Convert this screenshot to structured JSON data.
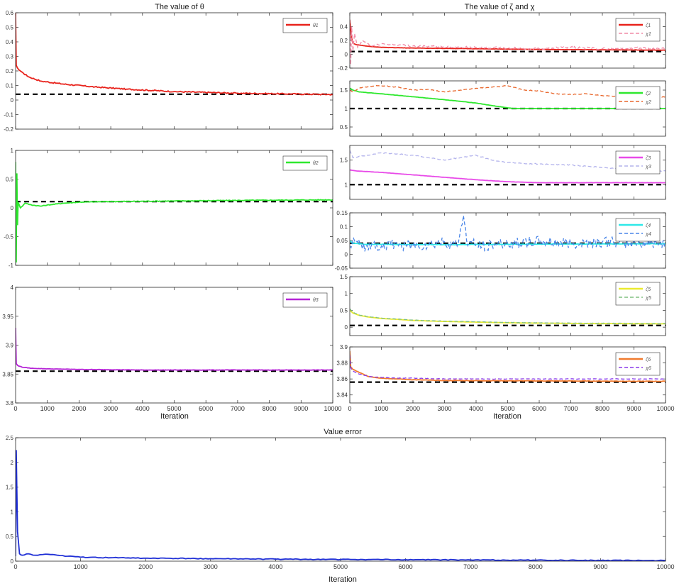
{
  "figure": {
    "title_theta": "The value of θ",
    "title_zeta": "The value of ζ and χ",
    "title_error": "Value error",
    "xlabel": "Iteration"
  },
  "colors": {
    "reference_line": "#000000",
    "axis": "#262626"
  },
  "chart_data": [
    {
      "id": "theta1",
      "type": "line",
      "xlim": [
        0,
        10000
      ],
      "ylim": [
        -0.2,
        0.6
      ],
      "yticks": [
        "-0.2",
        "-0.1",
        "0",
        "0.1",
        "0.2",
        "0.3",
        "0.4",
        "0.5",
        "0.6"
      ],
      "reference": 0.04,
      "series": [
        {
          "name": "θ1",
          "color": "#e8231c",
          "dash": false,
          "noise": 0.004,
          "x": [
            0,
            20,
            60,
            150,
            400,
            800,
            1500,
            2500,
            3500,
            5000,
            7000,
            10000
          ],
          "y": [
            0.6,
            0.24,
            0.22,
            0.2,
            0.16,
            0.13,
            0.11,
            0.09,
            0.075,
            0.058,
            0.047,
            0.038
          ]
        }
      ]
    },
    {
      "id": "theta2",
      "type": "line",
      "xlim": [
        0,
        10000
      ],
      "ylim": [
        -1,
        1
      ],
      "yticks": [
        "-1",
        "-0.5",
        "0",
        "0.5",
        "1"
      ],
      "reference": 0.11,
      "series": [
        {
          "name": "θ2",
          "color": "#2ee82e",
          "dash": false,
          "noise": 0.006,
          "x": [
            0,
            20,
            40,
            60,
            80,
            150,
            300,
            500,
            800,
            1000,
            1500,
            2000,
            3000,
            5000,
            7000,
            10000
          ],
          "y": [
            0.8,
            -0.95,
            0.6,
            -0.3,
            0.1,
            0.0,
            0.08,
            0.05,
            0.03,
            0.05,
            0.08,
            0.1,
            0.11,
            0.12,
            0.13,
            0.14
          ]
        }
      ]
    },
    {
      "id": "theta3",
      "type": "line",
      "xlim": [
        0,
        10000
      ],
      "ylim": [
        3.8,
        4.0
      ],
      "yticks": [
        "3.8",
        "3.85",
        "3.9",
        "3.95",
        "4"
      ],
      "reference": 3.855,
      "series": [
        {
          "name": "θ3",
          "color": "#b524d6",
          "dash": false,
          "noise": 0.0003,
          "x": [
            0,
            20,
            60,
            200,
            500,
            1000,
            2000,
            4000,
            10000
          ],
          "y": [
            3.93,
            3.868,
            3.865,
            3.862,
            3.86,
            3.859,
            3.858,
            3.857,
            3.857
          ]
        }
      ]
    },
    {
      "id": "zeta1",
      "type": "line",
      "xlim": [
        0,
        10000
      ],
      "ylim": [
        -0.2,
        0.6
      ],
      "yticks": [
        "-0.2",
        "0",
        "0.2",
        "0.4"
      ],
      "reference": 0.04,
      "series": [
        {
          "name": "ζ1",
          "color": "#e8231c",
          "dash": false,
          "noise": 0.002,
          "x": [
            0,
            50,
            100,
            200,
            500,
            1000,
            2000,
            4000,
            6000,
            8000,
            10000
          ],
          "y": [
            0.5,
            0.25,
            0.16,
            0.14,
            0.12,
            0.1,
            0.09,
            0.08,
            0.07,
            0.065,
            0.06
          ]
        },
        {
          "name": "χ1",
          "color": "#f08aa6",
          "dash": true,
          "noise": 0.015,
          "x": [
            0,
            30,
            60,
            100,
            150,
            250,
            400,
            700,
            1000,
            2000,
            3000,
            4000,
            5000,
            6000,
            7000,
            8000,
            9000,
            10000
          ],
          "y": [
            0.5,
            -0.15,
            0.4,
            0.05,
            0.3,
            0.1,
            0.2,
            0.12,
            0.15,
            0.12,
            0.11,
            0.1,
            0.09,
            0.08,
            0.1,
            0.08,
            0.09,
            0.08
          ]
        }
      ]
    },
    {
      "id": "zeta2",
      "type": "line",
      "xlim": [
        0,
        10000
      ],
      "ylim": [
        0.25,
        1.75
      ],
      "yticks": [
        "0.5",
        "1",
        "1.5"
      ],
      "reference": 1.0,
      "series": [
        {
          "name": "ζ2",
          "color": "#2ee82e",
          "dash": false,
          "noise": 0.003,
          "x": [
            0,
            100,
            300,
            1000,
            2000,
            3000,
            4000,
            4500,
            5000,
            5200,
            6000,
            10000
          ],
          "y": [
            1.55,
            1.5,
            1.45,
            1.4,
            1.32,
            1.24,
            1.15,
            1.08,
            1.02,
            1.0,
            1.0,
            1.0
          ]
        },
        {
          "name": "χ2",
          "color": "#e8662b",
          "dash": true,
          "noise": 0.01,
          "x": [
            0,
            100,
            300,
            600,
            1000,
            1500,
            2000,
            2500,
            3000,
            3500,
            4000,
            4500,
            5000,
            5500,
            6000,
            6500,
            7000,
            7500,
            8000,
            9000,
            10000
          ],
          "y": [
            1.5,
            1.45,
            1.55,
            1.6,
            1.62,
            1.58,
            1.5,
            1.52,
            1.45,
            1.5,
            1.55,
            1.58,
            1.62,
            1.5,
            1.48,
            1.4,
            1.38,
            1.4,
            1.35,
            1.3,
            1.32
          ]
        }
      ]
    },
    {
      "id": "zeta3",
      "type": "line",
      "xlim": [
        0,
        10000
      ],
      "ylim": [
        0.7,
        1.8
      ],
      "yticks": [
        "1",
        "1.5"
      ],
      "reference": 1.0,
      "series": [
        {
          "name": "ζ3",
          "color": "#e84ae8",
          "dash": false,
          "noise": 0.002,
          "x": [
            0,
            200,
            1000,
            2000,
            3000,
            4000,
            5000,
            6000,
            10000
          ],
          "y": [
            1.3,
            1.28,
            1.25,
            1.2,
            1.15,
            1.1,
            1.06,
            1.04,
            1.04
          ]
        },
        {
          "name": "χ3",
          "color": "#b3b3ec",
          "dash": true,
          "noise": 0.01,
          "x": [
            0,
            100,
            300,
            600,
            1000,
            2000,
            3000,
            3500,
            4000,
            4500,
            5000,
            6000,
            7000,
            8000,
            9000,
            10000
          ],
          "y": [
            1.7,
            1.55,
            1.58,
            1.6,
            1.65,
            1.6,
            1.5,
            1.55,
            1.6,
            1.5,
            1.45,
            1.42,
            1.4,
            1.35,
            1.3,
            1.28
          ]
        }
      ]
    },
    {
      "id": "zeta4",
      "type": "line",
      "xlim": [
        0,
        10000
      ],
      "ylim": [
        -0.05,
        0.15
      ],
      "yticks": [
        "-0.05",
        "0",
        "0.05",
        "0.1",
        "0.15"
      ],
      "reference": 0.04,
      "series": [
        {
          "name": "ζ4",
          "color": "#2ee8e8",
          "dash": false,
          "noise": 0.0008,
          "x": [
            0,
            100,
            500,
            1000,
            3000,
            6000,
            10000
          ],
          "y": [
            0.05,
            0.04,
            0.036,
            0.036,
            0.035,
            0.037,
            0.038
          ]
        },
        {
          "name": "χ4",
          "color": "#4a86e8",
          "dash": true,
          "noise": 0.02,
          "x": [
            0,
            200,
            400,
            700,
            1000,
            1500,
            2000,
            2500,
            3000,
            3400,
            3600,
            3700,
            4000,
            4500,
            5000,
            6000,
            7000,
            8000,
            9000,
            10000
          ],
          "y": [
            0.03,
            0.05,
            0.02,
            0.04,
            0.03,
            0.035,
            0.03,
            0.035,
            0.045,
            0.03,
            0.14,
            0.05,
            0.03,
            0.035,
            0.04,
            0.045,
            0.04,
            0.045,
            0.04,
            0.042
          ]
        }
      ]
    },
    {
      "id": "zeta5",
      "type": "line",
      "xlim": [
        0,
        10000
      ],
      "ylim": [
        -0.25,
        1.5
      ],
      "yticks": [
        "0",
        "0.5",
        "1",
        "1.5"
      ],
      "reference": 0.05,
      "series": [
        {
          "name": "ζ5",
          "color": "#eaea2e",
          "dash": false,
          "noise": 0.003,
          "x": [
            0,
            100,
            300,
            600,
            1000,
            2000,
            3000,
            5000,
            7000,
            10000
          ],
          "y": [
            0.5,
            0.42,
            0.35,
            0.3,
            0.26,
            0.2,
            0.17,
            0.13,
            0.11,
            0.1
          ]
        },
        {
          "name": "χ5",
          "color": "#80c080",
          "dash": true,
          "noise": 0.005,
          "x": [
            0,
            100,
            300,
            600,
            1000,
            2000,
            3000,
            5000,
            7000,
            10000
          ],
          "y": [
            0.55,
            0.44,
            0.36,
            0.31,
            0.27,
            0.21,
            0.18,
            0.14,
            0.12,
            0.11
          ]
        }
      ]
    },
    {
      "id": "zeta6",
      "type": "line",
      "xlim": [
        0,
        10000
      ],
      "ylim": [
        3.83,
        3.9
      ],
      "yticks": [
        "3.84",
        "3.86",
        "3.88",
        "3.9"
      ],
      "reference": 3.856,
      "series": [
        {
          "name": "ζ6",
          "color": "#f07a2e",
          "dash": false,
          "noise": 0.0003,
          "x": [
            0,
            30,
            100,
            300,
            600,
            1000,
            1500,
            2000,
            3000,
            10000
          ],
          "y": [
            3.895,
            3.875,
            3.872,
            3.868,
            3.863,
            3.861,
            3.86,
            3.859,
            3.858,
            3.857
          ]
        },
        {
          "name": "χ6",
          "color": "#8a3ae8",
          "dash": true,
          "noise": 0.0003,
          "x": [
            0,
            30,
            100,
            300,
            600,
            1000,
            1500,
            2000,
            3000,
            10000
          ],
          "y": [
            3.89,
            3.874,
            3.87,
            3.866,
            3.863,
            3.862,
            3.861,
            3.861,
            3.86,
            3.86
          ]
        }
      ]
    },
    {
      "id": "error",
      "type": "line",
      "xlim": [
        0,
        10000
      ],
      "ylim": [
        0,
        2.5
      ],
      "yticks": [
        "0",
        "0.5",
        "1",
        "1.5",
        "2",
        "2.5"
      ],
      "xticks": [
        "0",
        "1000",
        "2000",
        "3000",
        "4000",
        "5000",
        "6000",
        "7000",
        "8000",
        "9000",
        "10000"
      ],
      "series": [
        {
          "name": "Value error",
          "color": "#1f2fd6",
          "dash": false,
          "noise": 0.008,
          "x": [
            0,
            10,
            30,
            60,
            100,
            200,
            300,
            500,
            800,
            1000,
            1500,
            2000,
            3000,
            4000,
            5000,
            6000,
            7000,
            8000,
            9000,
            10000
          ],
          "y": [
            0.1,
            2.25,
            0.6,
            0.15,
            0.12,
            0.15,
            0.12,
            0.14,
            0.1,
            0.08,
            0.07,
            0.06,
            0.05,
            0.04,
            0.035,
            0.03,
            0.025,
            0.02,
            0.015,
            0.012
          ]
        }
      ]
    }
  ]
}
